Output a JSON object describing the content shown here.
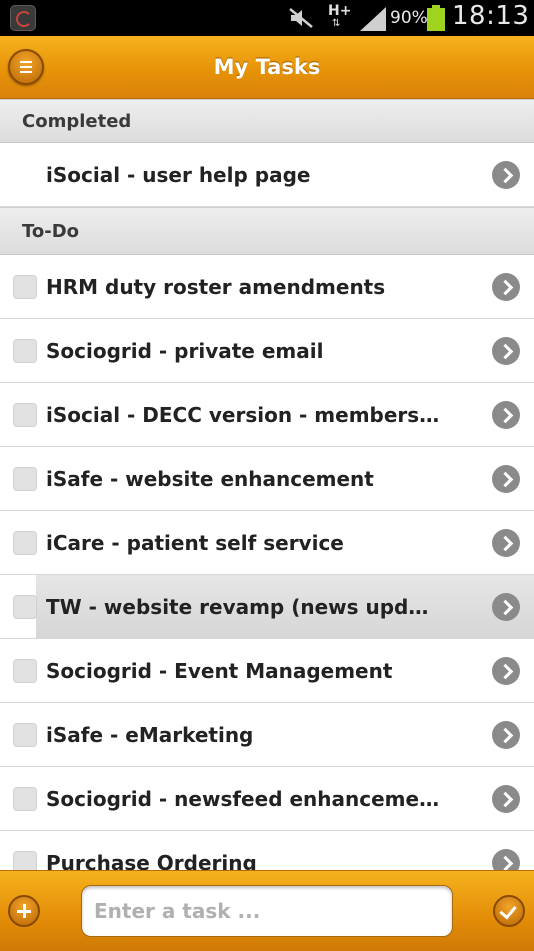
{
  "status_bar": {
    "network": "H+",
    "battery": "90%",
    "time": "18:13",
    "icons": [
      "app-notification-icon",
      "mute-icon",
      "signal-icon",
      "battery-icon"
    ]
  },
  "header": {
    "title": "My Tasks",
    "menu_icon": "menu-icon",
    "accent": "#e79308"
  },
  "sections": {
    "completed_label": "Completed",
    "todo_label": "To-Do"
  },
  "completed_tasks": [
    {
      "label": "iSocial - user help page"
    }
  ],
  "todo_tasks": [
    {
      "label": "HRM duty roster amendments"
    },
    {
      "label": "Sociogrid - private email"
    },
    {
      "label": "iSocial - DECC version - members…"
    },
    {
      "label": "iSafe - website enhancement"
    },
    {
      "label": "iCare - patient self service"
    },
    {
      "label": "TW - website revamp (news upda…"
    },
    {
      "label": "Sociogrid - Event Management"
    },
    {
      "label": "iSafe - eMarketing"
    },
    {
      "label": "Sociogrid - newsfeed enhancement"
    },
    {
      "label": "Purchase Ordering"
    }
  ],
  "footer": {
    "add_icon": "plus-icon",
    "input_placeholder": "Enter a task ...",
    "input_value": "",
    "done_icon": "checkmark-icon"
  }
}
